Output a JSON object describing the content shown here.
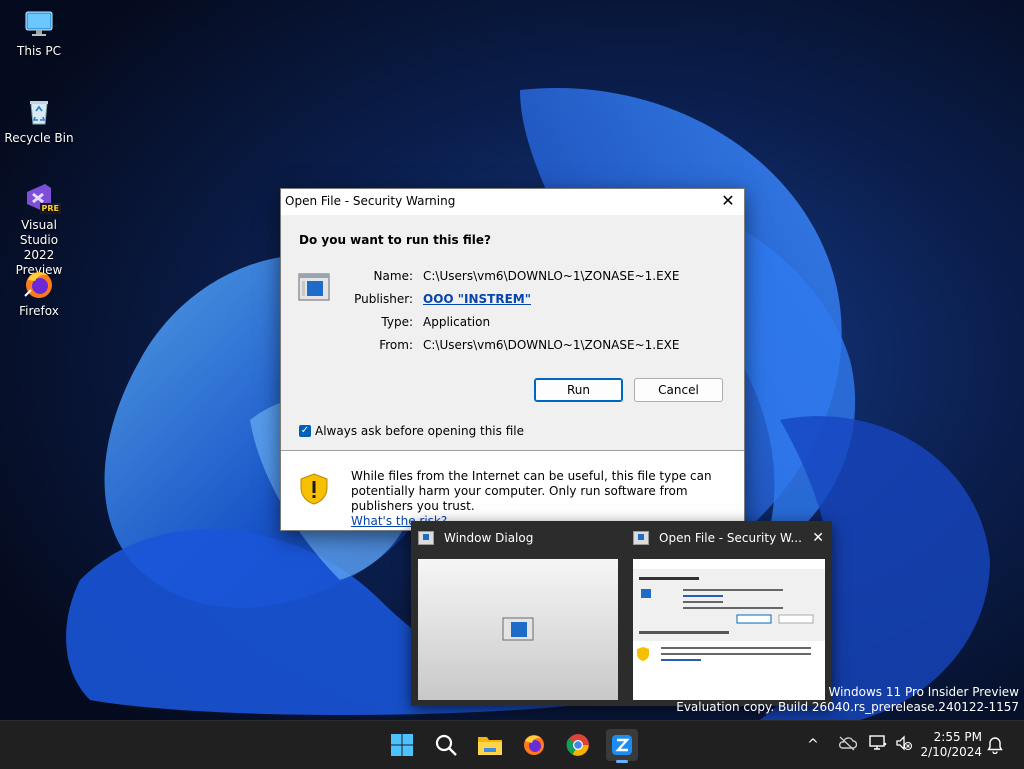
{
  "desktop": {
    "icons": [
      {
        "label_line1": "This PC",
        "label_line2": "",
        "icon": "computer-icon"
      },
      {
        "label_line1": "Recycle Bin",
        "label_line2": "",
        "icon": "recycle-bin-icon"
      },
      {
        "label_line1": "Visual Studio",
        "label_line2": "2022 Preview",
        "icon": "visual-studio-icon",
        "badge": "PRE"
      },
      {
        "label_line1": "Firefox",
        "label_line2": "",
        "icon": "firefox-icon"
      }
    ]
  },
  "dialog": {
    "title": "Open File - Security Warning",
    "close_glyph": "✕",
    "question": "Do you want to run this file?",
    "fields": [
      {
        "key": "Name:",
        "value": "C:\\Users\\vm6\\DOWNLO~1\\ZONASE~1.EXE"
      },
      {
        "key": "Publisher:",
        "value": "OOO \"INSTREM\""
      },
      {
        "key": "Type:",
        "value": "Application"
      },
      {
        "key": "From:",
        "value": "C:\\Users\\vm6\\DOWNLO~1\\ZONASE~1.EXE"
      }
    ],
    "run_label": "Run",
    "cancel_label": "Cancel",
    "checkbox_label": "Always ask before opening this file",
    "checkbox_checked": true,
    "warning_text": "While files from the Internet can be useful, this file type can potentially harm your computer. Only run software from publishers you trust.",
    "warning_link": "What's the risk?"
  },
  "preview": {
    "thumbs": [
      {
        "title": "Window Dialog"
      },
      {
        "title": "Open File - Security W..."
      }
    ],
    "close_glyph": "✕"
  },
  "watermark": {
    "line1": "Windows 11 Pro Insider Preview",
    "line2": "Evaluation copy. Build 26040.rs_prerelease.240122-1157"
  },
  "taskbar": {
    "items": [
      "start-icon",
      "search-icon",
      "file-explorer-icon",
      "firefox-icon",
      "chrome-icon",
      "zona-app-icon"
    ],
    "active_item": "zona-app-icon",
    "tray_chevron": "^"
  },
  "clock": {
    "time": "2:55 PM",
    "date": "2/10/2024"
  },
  "colors": {
    "accent": "#0067c0",
    "link": "#0645ad",
    "taskbar": "#202020"
  }
}
